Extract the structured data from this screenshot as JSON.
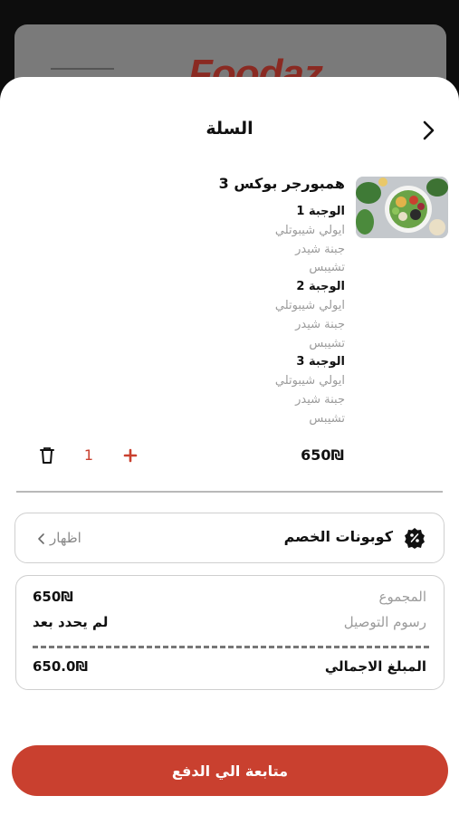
{
  "background": {
    "logo_text": "Foodaz"
  },
  "header": {
    "title": "السلة",
    "back_icon": "chevron-right-icon"
  },
  "cart_item": {
    "name": "همبورجر بوكس 3",
    "meals": [
      {
        "title": "الوجبة 1",
        "items": [
          "ايولي شيبوتلي",
          "جبنة شيدر",
          "تشيبس"
        ]
      },
      {
        "title": "الوجبة 2",
        "items": [
          "ايولي شيبوتلي",
          "جبنة شيدر",
          "تشيبس"
        ]
      },
      {
        "title": "الوجبة 3",
        "items": [
          "ايولي شيبوتلي",
          "جبنة شيدر",
          "تشيبس"
        ]
      }
    ],
    "price": "650₪",
    "quantity": "1",
    "delete_icon": "trash-icon",
    "increment_icon": "plus-icon",
    "image_icon": "salad-bowl-image"
  },
  "coupon": {
    "label": "كوبونات الخصم",
    "action": "اظهار",
    "icon": "discount-badge-icon",
    "chevron_icon": "chevron-left-icon"
  },
  "summary": {
    "subtotal_label": "المجموع",
    "subtotal_value": "650₪",
    "delivery_label": "رسوم التوصيل",
    "delivery_value": "لم يحدد بعد",
    "total_label": "المبلغ الاجمالي",
    "total_value": "650.0₪"
  },
  "cta": {
    "label": "متابعة الي الدفع"
  },
  "colors": {
    "accent": "#c9402f",
    "muted_text": "#9b9b9b",
    "border": "#cfcfcf"
  }
}
